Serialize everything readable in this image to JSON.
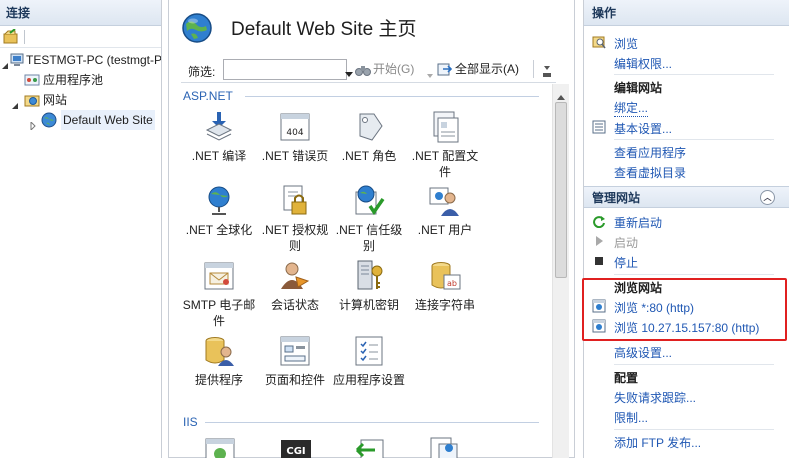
{
  "left_pane": {
    "header": "连接",
    "tree": [
      {
        "label": "TESTMGT-PC (testmgt-PC\\Administrator)",
        "level": 0
      },
      {
        "label": "应用程序池",
        "level": 1
      },
      {
        "label": "网站",
        "level": 1
      },
      {
        "label": "Default Web Site",
        "level": 2
      }
    ]
  },
  "center": {
    "title": "Default Web Site 主页",
    "filter": {
      "label": "筛选:",
      "value": "",
      "start_label": "开始(G)",
      "show_all_label": "全部显示(A)"
    },
    "groups": {
      "aspnet": "ASP.NET",
      "iis": "IIS"
    },
    "features": [
      {
        "label": ".NET 编译"
      },
      {
        "label": ".NET 错误页"
      },
      {
        "label": ".NET 角色"
      },
      {
        "label": ".NET 配置文件"
      },
      {
        "label": ".NET 全球化"
      },
      {
        "label": ".NET 授权规则"
      },
      {
        "label": ".NET 信任级别"
      },
      {
        "label": ".NET 用户"
      },
      {
        "label": "SMTP 电子邮件"
      },
      {
        "label": "会话状态"
      },
      {
        "label": "计算机密钥"
      },
      {
        "label": "连接字符串"
      },
      {
        "label": "提供程序"
      },
      {
        "label": "页面和控件"
      },
      {
        "label": "应用程序设置"
      }
    ],
    "iis_icon_text": "CGI"
  },
  "actions": {
    "header": "操作",
    "browse": "浏览",
    "edit_permissions": "编辑权限...",
    "edit_site_heading": "编辑网站",
    "bindings": "绑定...",
    "basic_settings": "基本设置...",
    "view_apps": "查看应用程序",
    "view_vdirs": "查看虚拟目录",
    "manage_site_header": "管理网站",
    "restart": "重新启动",
    "start": "启动",
    "stop": "停止",
    "browse_site_heading": "浏览网站",
    "browse_80": "浏览 *:80 (http)",
    "browse_ip": "浏览 10.27.15.157:80 (http)",
    "advanced_settings": "高级设置...",
    "config_heading": "配置",
    "failed_request_tracing": "失败请求跟踪...",
    "limits": "限制...",
    "add_ftp": "添加 FTP 发布..."
  },
  "colors": {
    "link": "#1f57b3",
    "highlight": "#e02020",
    "group_header": "#2a63b3"
  }
}
